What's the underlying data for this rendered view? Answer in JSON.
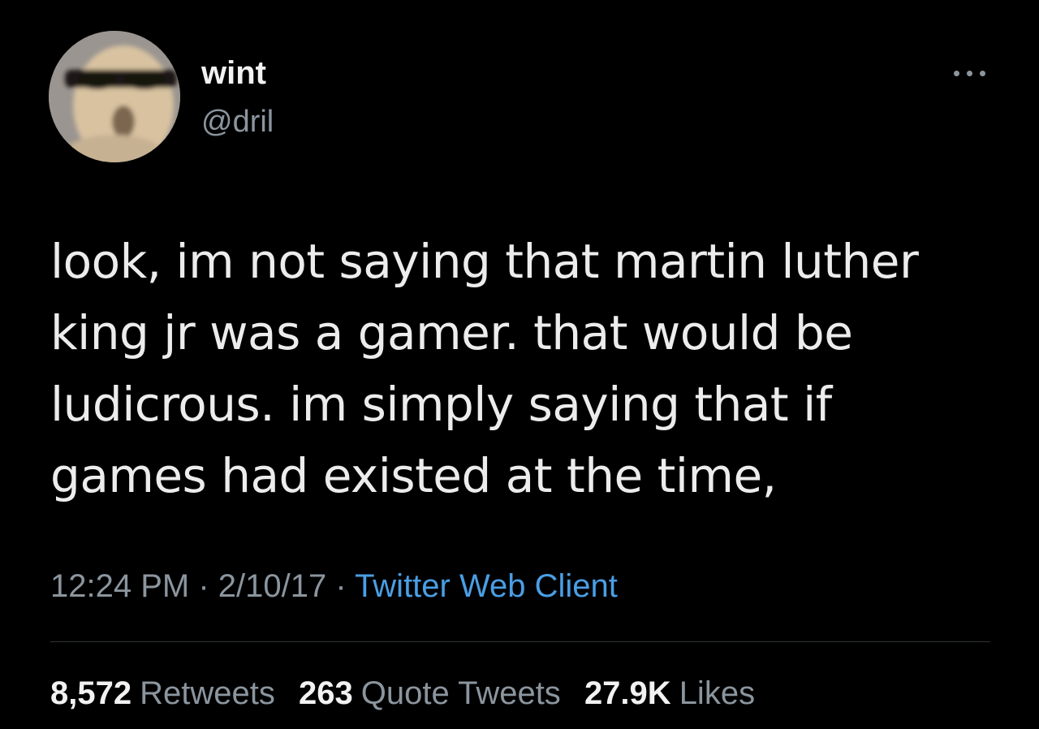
{
  "user": {
    "display_name": "wint",
    "handle": "@dril"
  },
  "tweet": {
    "text": "look, im not saying that martin luther\nking jr was a gamer. that would be\nludicrous. im simply saying that if\ngames had existed at the time,"
  },
  "meta": {
    "time": "12:24 PM",
    "sep1": " · ",
    "date": "2/10/17",
    "sep2": " · ",
    "source": "Twitter Web Client"
  },
  "stats": {
    "retweets_count": "8,572",
    "retweets_label": "Retweets",
    "quotes_count": "263",
    "quotes_label": "Quote Tweets",
    "likes_count": "27.9K",
    "likes_label": "Likes"
  },
  "icons": {
    "more": "more-horizontal-icon"
  },
  "colors": {
    "background": "#000000",
    "link": "#4a9ee5",
    "secondary_text": "#8b959e",
    "primary_text": "#ececec"
  }
}
